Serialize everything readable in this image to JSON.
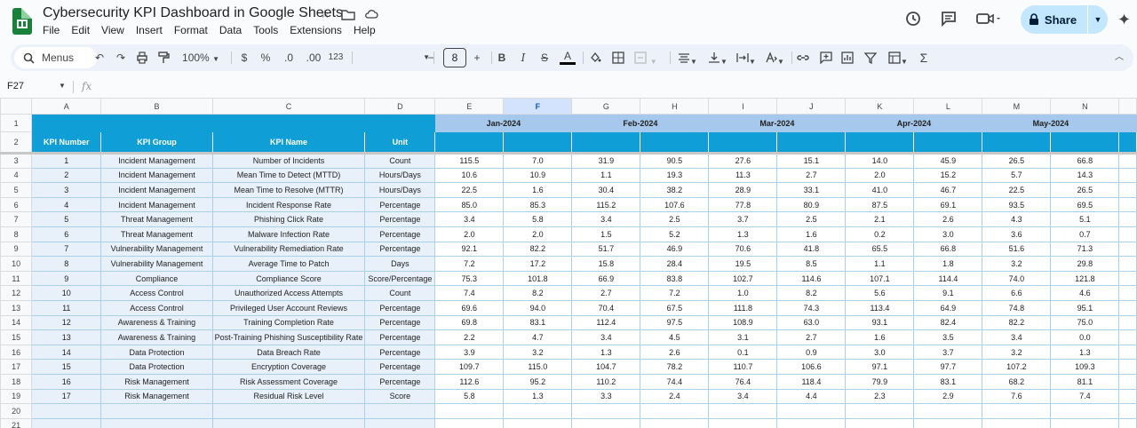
{
  "app": {
    "title": "Cybersecurity KPI Dashboard in Google Sheets",
    "menus": [
      "File",
      "Edit",
      "View",
      "Insert",
      "Format",
      "Data",
      "Tools",
      "Extensions",
      "Help"
    ],
    "share_label": "Share"
  },
  "toolbar": {
    "menus_label": "Menus",
    "zoom": "100%",
    "currency": "$",
    "percent": "%",
    "dec_decrease": ".0",
    "dec_increase": ".00",
    "number_format": "123",
    "font_size": "8",
    "minus": "−",
    "plus": "+",
    "bold": "B",
    "italic": "I",
    "strike": "S",
    "text_color": "A"
  },
  "formula_bar": {
    "name_box": "F27",
    "fx": "fx"
  },
  "sheet": {
    "columns": [
      "A",
      "B",
      "C",
      "D",
      "E",
      "F",
      "G",
      "H",
      "I",
      "J",
      "K",
      "L",
      "M",
      "N"
    ],
    "selected_column": "F",
    "months": [
      "Jan-2024",
      "Feb-2024",
      "Mar-2024",
      "Apr-2024",
      "May-2024"
    ],
    "headers": [
      "KPI Number",
      "KPI Group",
      "KPI Name",
      "Unit"
    ],
    "rows": [
      {
        "n": "1",
        "group": "Incident Management",
        "name": "Number of Incidents",
        "unit": "Count",
        "vals": [
          "115.5",
          "7.0",
          "31.9",
          "90.5",
          "27.6",
          "15.1",
          "14.0",
          "45.9",
          "26.5",
          "66.8"
        ]
      },
      {
        "n": "2",
        "group": "Incident Management",
        "name": "Mean Time to Detect (MTTD)",
        "unit": "Hours/Days",
        "vals": [
          "10.6",
          "10.9",
          "1.1",
          "19.3",
          "11.3",
          "2.7",
          "2.0",
          "15.2",
          "5.7",
          "14.3"
        ]
      },
      {
        "n": "3",
        "group": "Incident Management",
        "name": "Mean Time to Resolve (MTTR)",
        "unit": "Hours/Days",
        "vals": [
          "22.5",
          "1.6",
          "30.4",
          "38.2",
          "28.9",
          "33.1",
          "41.0",
          "46.7",
          "22.5",
          "26.5"
        ]
      },
      {
        "n": "4",
        "group": "Incident Management",
        "name": "Incident Response Rate",
        "unit": "Percentage",
        "vals": [
          "85.0",
          "85.3",
          "115.2",
          "107.6",
          "77.8",
          "80.9",
          "87.5",
          "69.1",
          "93.5",
          "69.5"
        ]
      },
      {
        "n": "5",
        "group": "Threat Management",
        "name": "Phishing Click Rate",
        "unit": "Percentage",
        "vals": [
          "3.4",
          "5.8",
          "3.4",
          "2.5",
          "3.7",
          "2.5",
          "2.1",
          "2.6",
          "4.3",
          "5.1"
        ]
      },
      {
        "n": "6",
        "group": "Threat Management",
        "name": "Malware Infection Rate",
        "unit": "Percentage",
        "vals": [
          "2.0",
          "2.0",
          "1.5",
          "5.2",
          "1.3",
          "1.6",
          "0.2",
          "3.0",
          "3.6",
          "0.7"
        ]
      },
      {
        "n": "7",
        "group": "Vulnerability Management",
        "name": "Vulnerability Remediation Rate",
        "unit": "Percentage",
        "vals": [
          "92.1",
          "82.2",
          "51.7",
          "46.9",
          "70.6",
          "41.8",
          "65.5",
          "66.8",
          "51.6",
          "71.3"
        ]
      },
      {
        "n": "8",
        "group": "Vulnerability Management",
        "name": "Average Time to Patch",
        "unit": "Days",
        "vals": [
          "7.2",
          "17.2",
          "15.8",
          "28.4",
          "19.5",
          "8.5",
          "1.1",
          "1.8",
          "3.2",
          "29.8"
        ]
      },
      {
        "n": "9",
        "group": "Compliance",
        "name": "Compliance Score",
        "unit": "Score/Percentage",
        "vals": [
          "75.3",
          "101.8",
          "66.9",
          "83.8",
          "102.7",
          "114.6",
          "107.1",
          "114.4",
          "74.0",
          "121.8"
        ]
      },
      {
        "n": "10",
        "group": "Access Control",
        "name": "Unauthorized Access Attempts",
        "unit": "Count",
        "vals": [
          "7.4",
          "8.2",
          "2.7",
          "7.2",
          "1.0",
          "8.2",
          "5.6",
          "9.1",
          "6.6",
          "4.6"
        ]
      },
      {
        "n": "11",
        "group": "Access Control",
        "name": "Privileged User Account Reviews",
        "unit": "Percentage",
        "vals": [
          "69.6",
          "94.0",
          "70.4",
          "67.5",
          "111.8",
          "74.3",
          "113.4",
          "64.9",
          "74.8",
          "95.1"
        ]
      },
      {
        "n": "12",
        "group": "Awareness & Training",
        "name": "Training Completion Rate",
        "unit": "Percentage",
        "vals": [
          "69.8",
          "83.1",
          "112.4",
          "97.5",
          "108.9",
          "63.0",
          "93.1",
          "82.4",
          "82.2",
          "75.0"
        ]
      },
      {
        "n": "13",
        "group": "Awareness & Training",
        "name": "Post-Training Phishing Susceptibility Rate",
        "unit": "Percentage",
        "vals": [
          "2.2",
          "4.7",
          "3.4",
          "4.5",
          "3.1",
          "2.7",
          "1.6",
          "3.5",
          "3.4",
          "0.0"
        ]
      },
      {
        "n": "14",
        "group": "Data Protection",
        "name": "Data Breach Rate",
        "unit": "Percentage",
        "vals": [
          "3.9",
          "3.2",
          "1.3",
          "2.6",
          "0.1",
          "0.9",
          "3.0",
          "3.7",
          "3.2",
          "1.3"
        ]
      },
      {
        "n": "15",
        "group": "Data Protection",
        "name": "Encryption Coverage",
        "unit": "Percentage",
        "vals": [
          "109.7",
          "115.0",
          "104.7",
          "78.2",
          "110.7",
          "106.6",
          "97.1",
          "97.7",
          "107.2",
          "109.3"
        ]
      },
      {
        "n": "16",
        "group": "Risk Management",
        "name": "Risk Assessment Coverage",
        "unit": "Percentage",
        "vals": [
          "112.6",
          "95.2",
          "110.2",
          "74.4",
          "76.4",
          "118.4",
          "79.9",
          "83.1",
          "68.2",
          "81.1"
        ]
      },
      {
        "n": "17",
        "group": "Risk Management",
        "name": "Residual Risk Level",
        "unit": "Score",
        "vals": [
          "5.8",
          "1.3",
          "3.3",
          "2.4",
          "3.4",
          "4.4",
          "2.3",
          "2.9",
          "7.6",
          "7.4"
        ]
      }
    ],
    "row_numbers": [
      "1",
      "2",
      "3",
      "4",
      "5",
      "6",
      "7",
      "8",
      "9",
      "10",
      "11",
      "12",
      "13",
      "14",
      "15",
      "16",
      "17",
      "18",
      "19",
      "20",
      "21"
    ]
  }
}
